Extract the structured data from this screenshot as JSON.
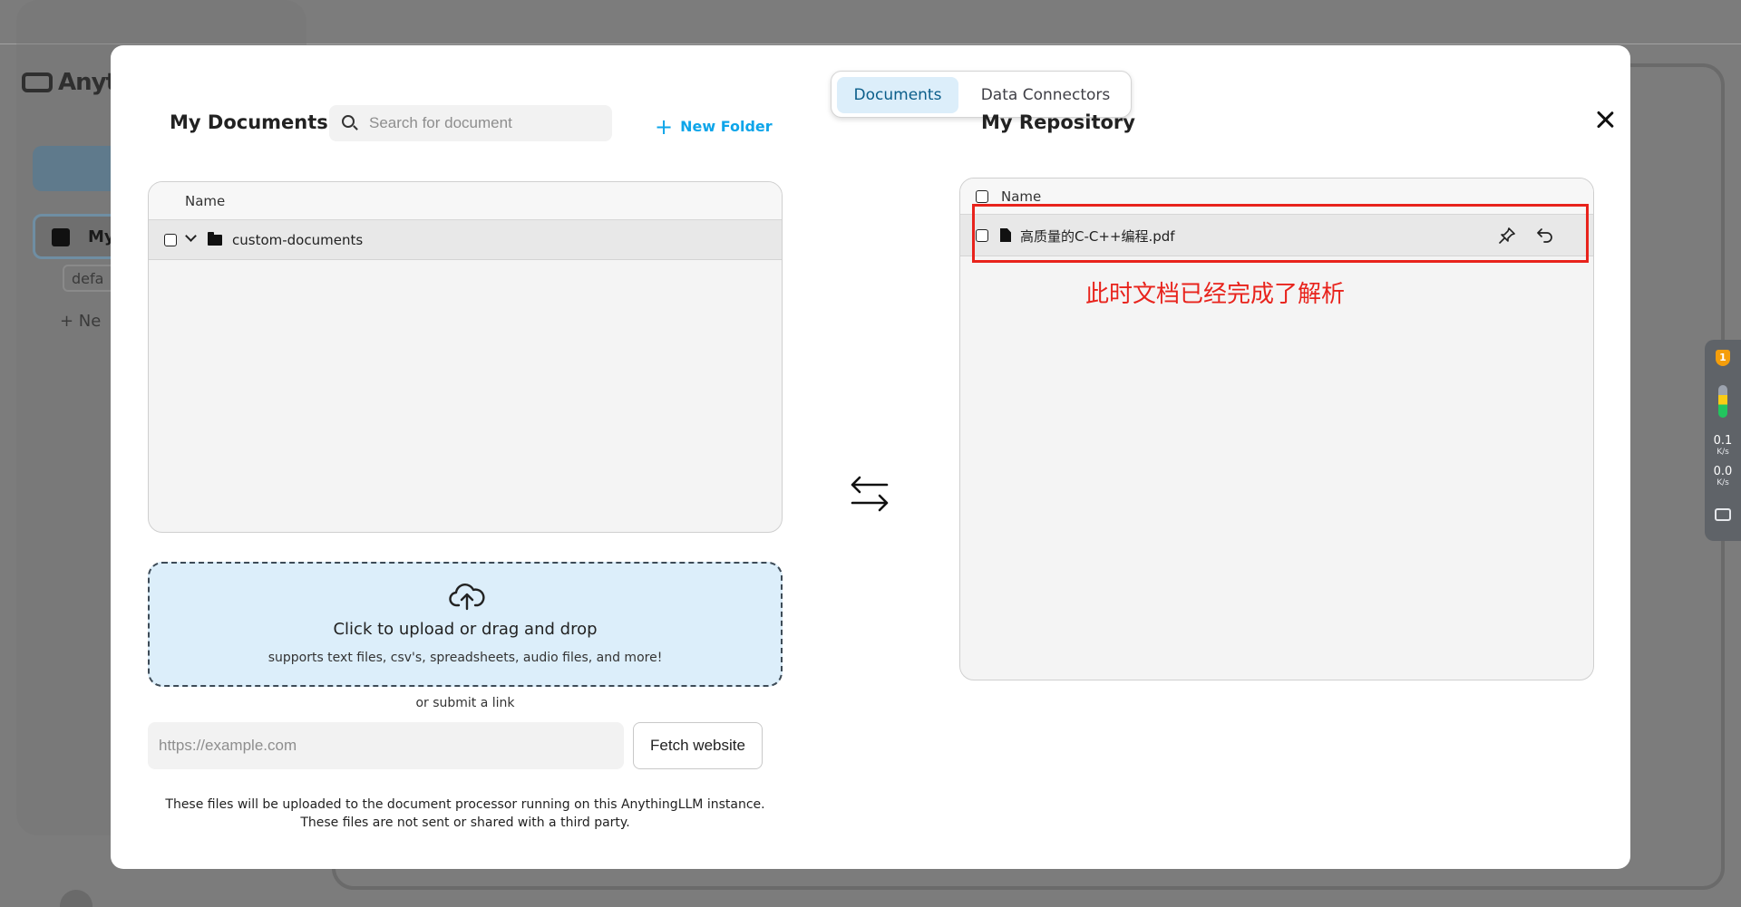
{
  "background_app": {
    "logo_text": "Anyth",
    "workspace_label": "My",
    "thread_label": "defa",
    "new_thread_label": "+ Ne"
  },
  "tabs": [
    {
      "label": "Documents",
      "active": true
    },
    {
      "label": "Data Connectors",
      "active": false
    }
  ],
  "my_documents": {
    "title": "My Documents",
    "search_placeholder": "Search for document",
    "new_folder_label": "New Folder",
    "column_name": "Name",
    "items": [
      {
        "type": "folder",
        "name": "custom-documents",
        "expanded": true
      }
    ]
  },
  "upload": {
    "title": "Click to upload or drag and drop",
    "subtitle": "supports text files, csv's, spreadsheets, audio files, and more!",
    "or_link": "or submit a link",
    "url_placeholder": "https://example.com",
    "fetch_label": "Fetch website",
    "footnote_line1": "These files will be uploaded to the document processor running on this AnythingLLM instance.",
    "footnote_line2": "These files are not sent or shared with a third party."
  },
  "my_repository": {
    "title": "My Repository",
    "column_name": "Name",
    "items": [
      {
        "type": "file",
        "name": "高质量的C-C++编程.pdf"
      }
    ]
  },
  "annotation": {
    "text": "此时文档已经完成了解析",
    "color": "#e8231c"
  },
  "widget": {
    "badge": "1",
    "upload_speed": "0.1",
    "download_speed": "0.0",
    "speed_unit": "K/s"
  },
  "colors": {
    "accent": "#0ea5e9",
    "active_tab_bg": "#dceefa",
    "annotation_red": "#e8231c"
  }
}
